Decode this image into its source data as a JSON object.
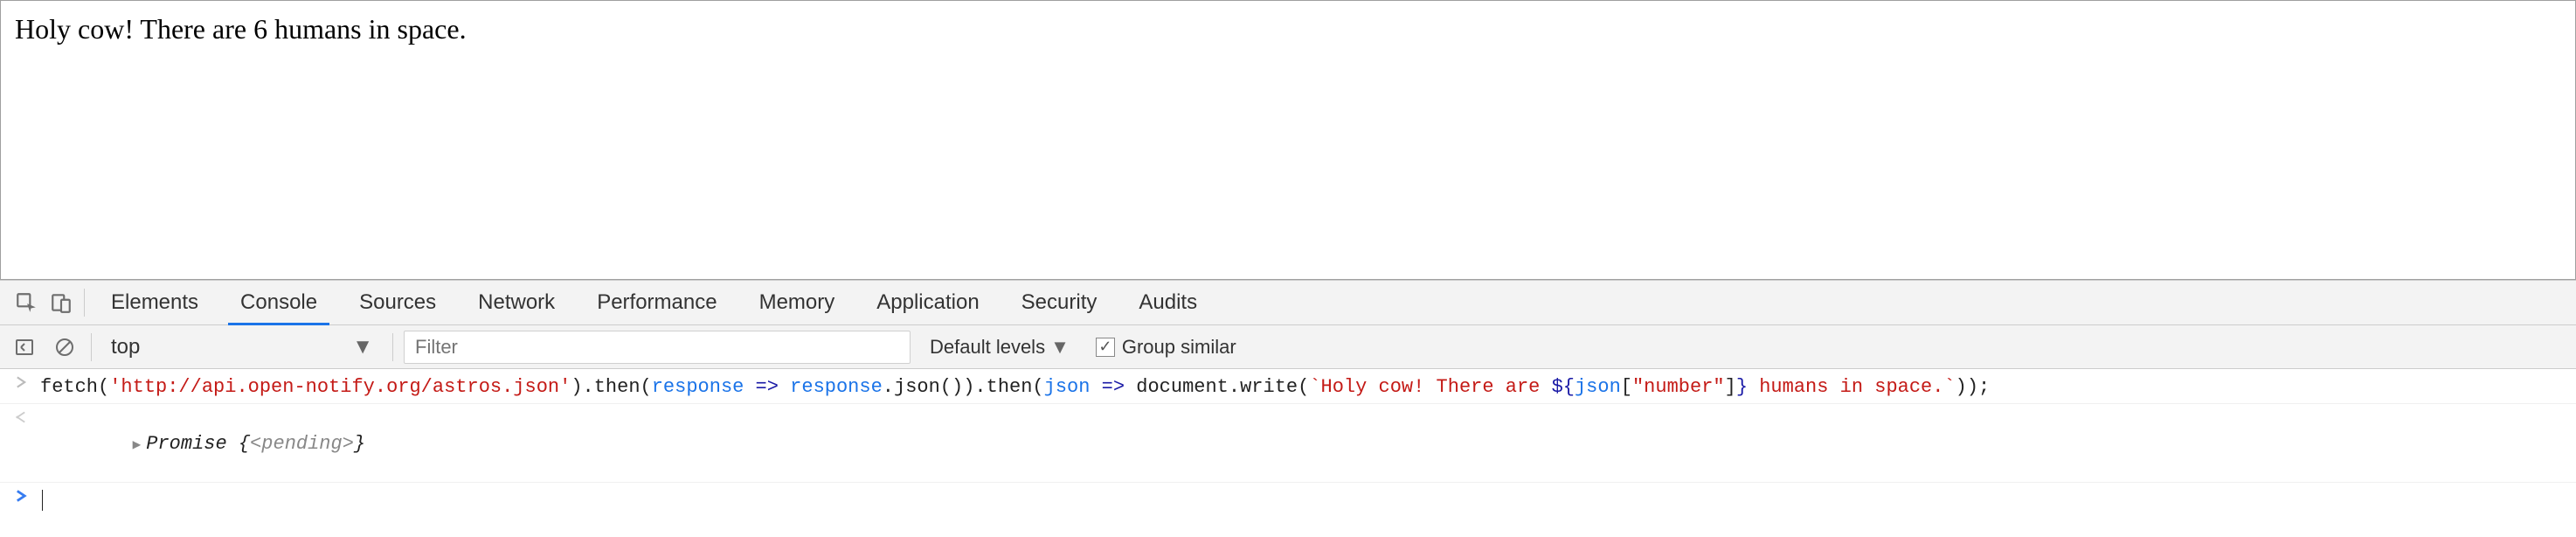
{
  "viewport": {
    "text": "Holy cow! There are 6 humans in space."
  },
  "tabs": [
    {
      "label": "Elements"
    },
    {
      "label": "Console"
    },
    {
      "label": "Sources"
    },
    {
      "label": "Network"
    },
    {
      "label": "Performance"
    },
    {
      "label": "Memory"
    },
    {
      "label": "Application"
    },
    {
      "label": "Security"
    },
    {
      "label": "Audits"
    }
  ],
  "active_tab_index": 1,
  "toolbar": {
    "context_select": "top",
    "filter_placeholder": "Filter",
    "levels_label": "Default levels",
    "group_similar_checked": true,
    "group_similar_label": "Group similar"
  },
  "console": {
    "input_tokens": [
      {
        "t": "fetch(",
        "cls": "t-ident"
      },
      {
        "t": "'http://api.open-notify.org/astros.json'",
        "cls": "t-str"
      },
      {
        "t": ").then(",
        "cls": "t-ident"
      },
      {
        "t": "response",
        "cls": "t-param"
      },
      {
        "t": " => ",
        "cls": "t-key"
      },
      {
        "t": "response",
        "cls": "t-param"
      },
      {
        "t": ".json()).then(",
        "cls": "t-ident"
      },
      {
        "t": "json",
        "cls": "t-param"
      },
      {
        "t": " => ",
        "cls": "t-key"
      },
      {
        "t": "document.write(",
        "cls": "t-ident"
      },
      {
        "t": "`Holy cow! There are ",
        "cls": "t-str"
      },
      {
        "t": "${",
        "cls": "t-key"
      },
      {
        "t": "json",
        "cls": "t-param"
      },
      {
        "t": "[",
        "cls": "t-ident"
      },
      {
        "t": "\"number\"",
        "cls": "t-str"
      },
      {
        "t": "]",
        "cls": "t-ident"
      },
      {
        "t": "}",
        "cls": "t-key"
      },
      {
        "t": " humans in space.`",
        "cls": "t-str"
      },
      {
        "t": "));",
        "cls": "t-ident"
      }
    ],
    "result_tokens": [
      {
        "t": "Promise {",
        "cls": "t-ident t-italic"
      },
      {
        "t": "<pending>",
        "cls": "t-muted t-italic"
      },
      {
        "t": "}",
        "cls": "t-ident t-italic"
      }
    ]
  }
}
